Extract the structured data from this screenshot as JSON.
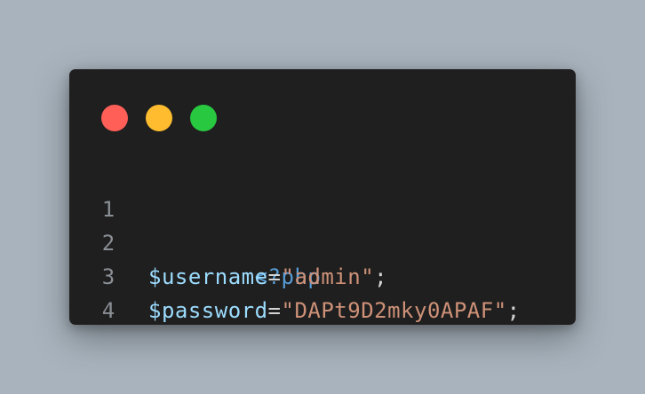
{
  "colors": {
    "background": "#a8b3bd",
    "window": "#1f1f1f",
    "close_dot": "#ff5f57",
    "minimize_dot": "#febc2e",
    "maximize_dot": "#28c840",
    "line_number": "#8a8f95",
    "php_tag": "#569cd6",
    "variable": "#9cdcfe",
    "operator": "#d4d4d4",
    "string": "#ce9178",
    "punctuation": "#d4d4d4"
  },
  "window_controls": {
    "close_icon": "red-dot",
    "minimize_icon": "yellow-dot",
    "maximize_icon": "green-dot"
  },
  "code": {
    "lines": [
      {
        "number": "1",
        "tokens": [
          {
            "text": "<?php",
            "kind": "php_tag"
          }
        ]
      },
      {
        "number": "2",
        "tokens": [
          {
            "text": "$username",
            "kind": "variable"
          },
          {
            "text": "=",
            "kind": "operator"
          },
          {
            "text": "\"admin\"",
            "kind": "string"
          },
          {
            "text": ";",
            "kind": "punctuation"
          }
        ]
      },
      {
        "number": "3",
        "tokens": [
          {
            "text": "$password",
            "kind": "variable"
          },
          {
            "text": "=",
            "kind": "operator"
          },
          {
            "text": "\"DAPt9D2mky0APAF\"",
            "kind": "string"
          },
          {
            "text": ";",
            "kind": "punctuation"
          }
        ]
      },
      {
        "number": "4",
        "tokens": []
      }
    ]
  }
}
